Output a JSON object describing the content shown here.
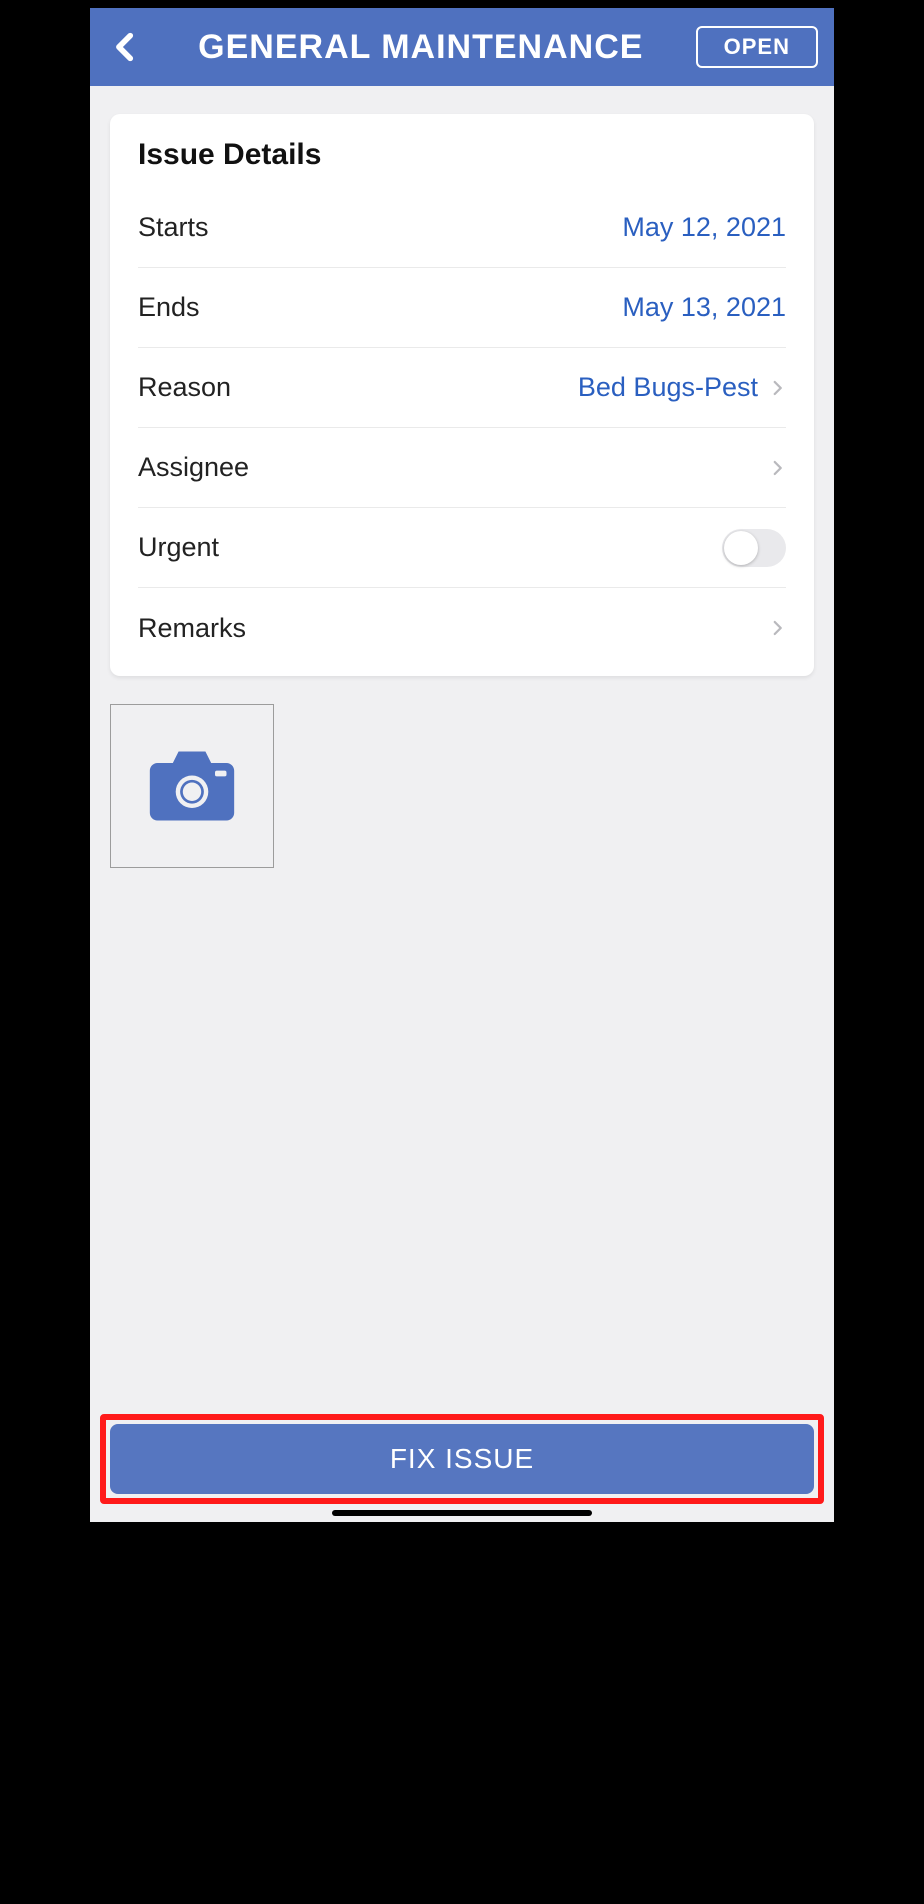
{
  "header": {
    "title": "GENERAL MAINTENANCE",
    "open_label": "OPEN"
  },
  "card": {
    "title": "Issue Details",
    "rows": {
      "starts": {
        "label": "Starts",
        "value": "May 12, 2021"
      },
      "ends": {
        "label": "Ends",
        "value": "May 13, 2021"
      },
      "reason": {
        "label": "Reason",
        "value": "Bed Bugs-Pest"
      },
      "assignee": {
        "label": "Assignee",
        "value": ""
      },
      "urgent": {
        "label": "Urgent",
        "on": false
      },
      "remarks": {
        "label": "Remarks",
        "value": ""
      }
    }
  },
  "footer": {
    "fix_label": "FIX ISSUE"
  }
}
